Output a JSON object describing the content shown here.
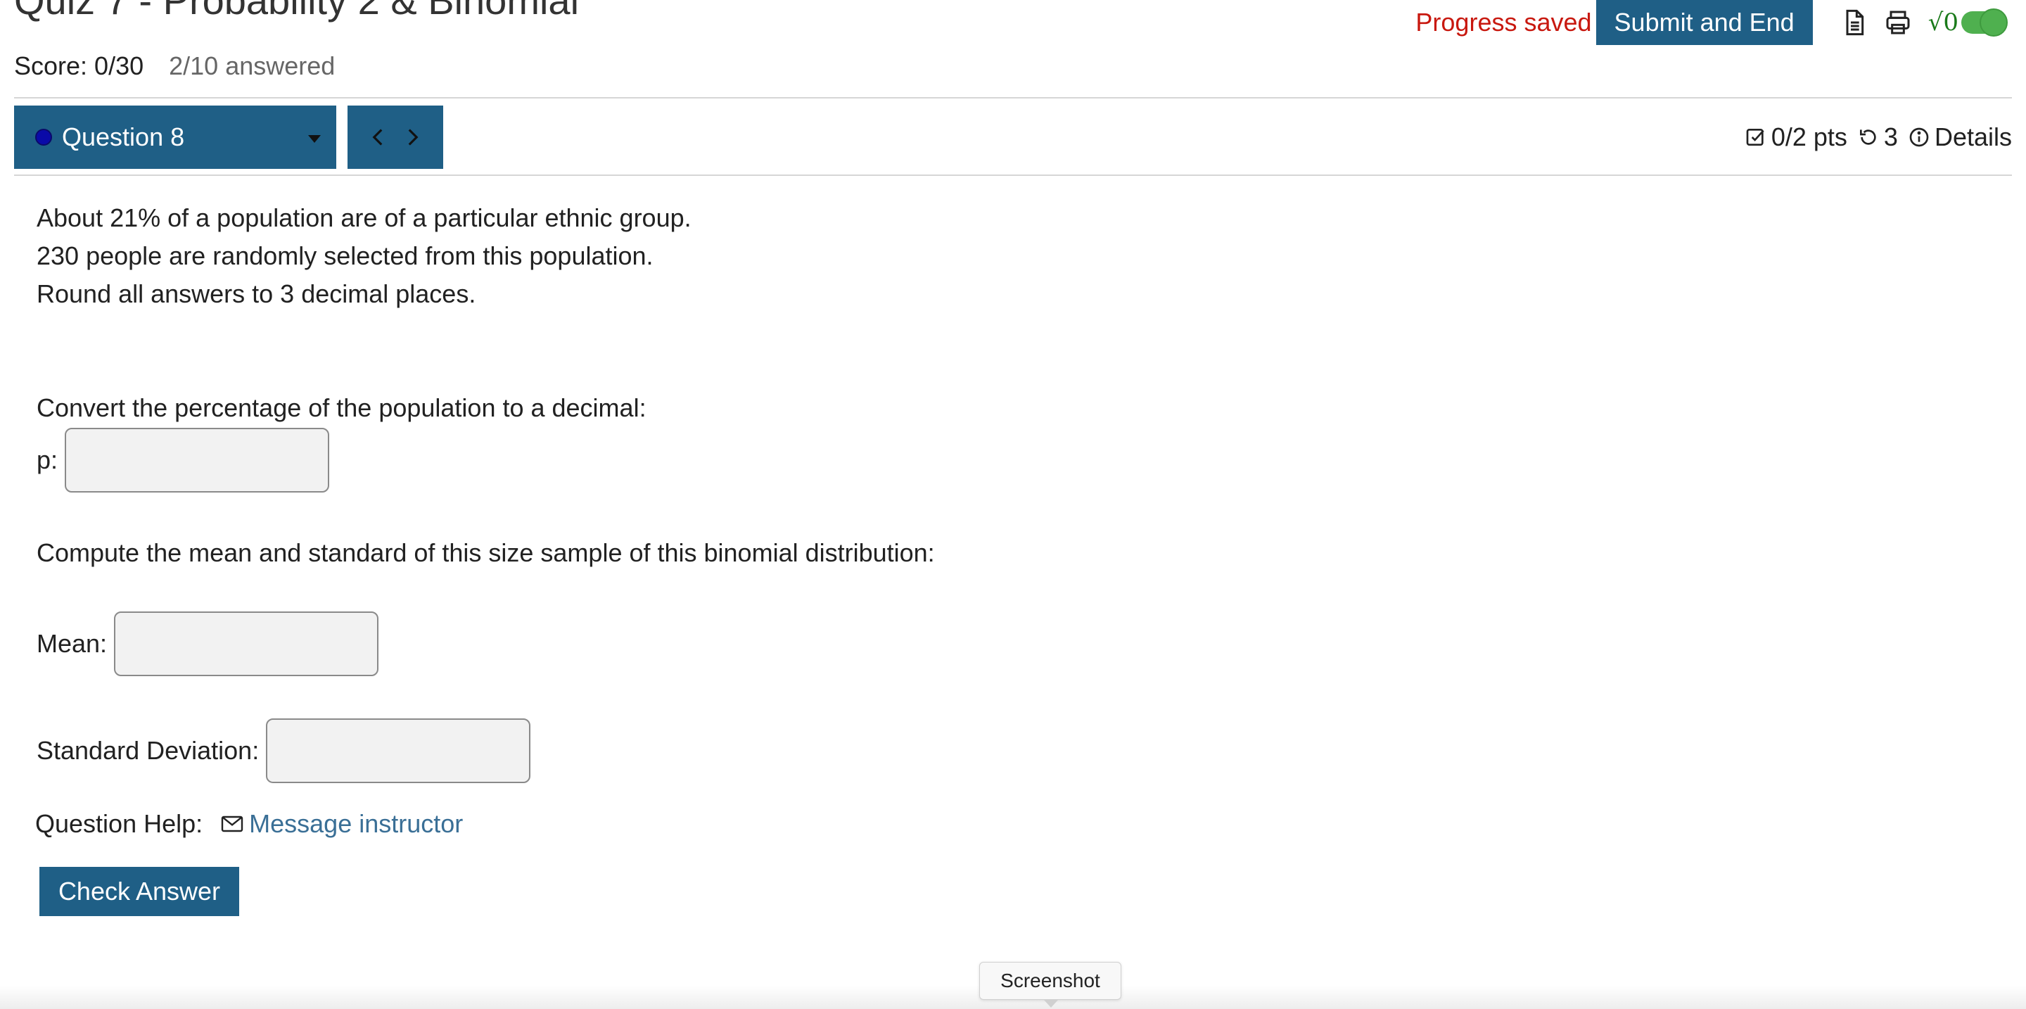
{
  "header": {
    "quiz_title": "Quiz 7 - Probability 2 & Binomial",
    "progress_status": "Progress saved",
    "submit_label": "Submit and End",
    "icons": [
      "document-icon",
      "print-icon",
      "sqrt-toggle-icon"
    ],
    "sqrt_symbol": "√0"
  },
  "score": {
    "score_text": "Score: 0/30",
    "answered_text": "2/10 answered"
  },
  "question_nav": {
    "current_question": "Question 8",
    "points": "0/2 pts",
    "attempts": "3",
    "details_label": "Details"
  },
  "question": {
    "line1": "About 21% of a population are of a particular ethnic group.",
    "line2": "230 people are randomly selected from this population.",
    "line3": "Round all answers to 3 decimal places.",
    "part1_prompt": "Convert the percentage of the population to a decimal:",
    "p_label": "p:",
    "part2_prompt": "Compute the mean and standard of this size sample of this binomial distribution:",
    "mean_label": "Mean:",
    "sd_label": "Standard Deviation:"
  },
  "help": {
    "label": "Question Help:",
    "message_link": "Message instructor"
  },
  "actions": {
    "check_answer": "Check Answer"
  },
  "tooltip": {
    "text": "Screenshot"
  },
  "colors": {
    "primary": "#1f5f86",
    "progress_saved": "#c8180f",
    "link": "#3a6f96",
    "toggle": "#4fb04f"
  }
}
